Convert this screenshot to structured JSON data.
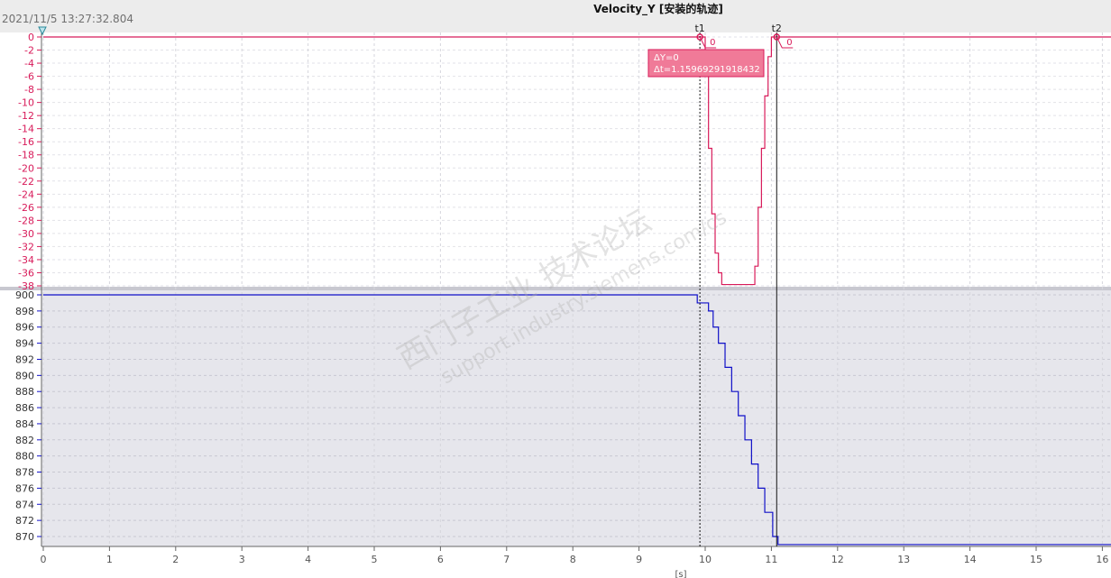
{
  "header": {
    "timestamp": "2021/11/5 13:27:32.804",
    "title": "Velocity_Y [安装的轨迹]"
  },
  "cursors": {
    "t1_label": "t1",
    "t2_label": "t2",
    "t1_value_label": "0",
    "t2_value_label": "0",
    "delta_y": "ΔY=0",
    "delta_t": "Δt=1.15969291918432"
  },
  "watermark": {
    "line1": "西门子工业  技术论坛",
    "line2": "support.industry.siemens.com/cs"
  },
  "colors": {
    "top_series": "#d81b5a",
    "bottom_series": "#1010c8",
    "cursor_box": "#f07a98",
    "lower_panel_bg": "#e6e6ec"
  },
  "chart_data": [
    {
      "type": "line",
      "title": "Velocity_Y [安装的轨迹]",
      "ylim": [
        -39,
        0
      ],
      "yticks": [
        0,
        -2,
        -4,
        -6,
        -8,
        -10,
        -12,
        -14,
        -16,
        -18,
        -20,
        -22,
        -24,
        -26,
        -28,
        -30,
        -32,
        -34,
        -36,
        -38
      ],
      "xlim": [
        0,
        16.2
      ],
      "grid": true,
      "step": true,
      "series": [
        {
          "x": [
            0,
            9.92,
            10.0,
            10.05,
            10.1,
            10.15,
            10.2,
            10.25,
            10.3,
            10.35,
            10.4,
            10.5,
            10.6,
            10.65,
            10.7,
            10.75,
            10.8,
            10.85,
            10.9,
            10.95,
            11.0,
            11.05,
            16.2
          ],
          "y": [
            0,
            0,
            -3,
            -17,
            -27,
            -33,
            -36,
            -37.8,
            -37.8,
            -37.8,
            -37.8,
            -37.8,
            -37.8,
            -37.8,
            -37.8,
            -35,
            -26,
            -17,
            -9,
            -3,
            0,
            0,
            0
          ]
        }
      ]
    },
    {
      "type": "line",
      "ylim": [
        869.5,
        900.8
      ],
      "yticks": [
        900,
        898,
        896,
        894,
        892,
        890,
        888,
        886,
        884,
        882,
        880,
        878,
        876,
        874,
        872,
        870
      ],
      "xlim": [
        0,
        16.2
      ],
      "xticks": [
        0,
        1,
        2,
        3,
        4,
        5,
        6,
        7,
        8,
        9,
        10,
        11,
        12,
        13,
        14,
        15,
        16
      ],
      "xlabel": "[s]",
      "grid": true,
      "step": true,
      "series": [
        {
          "x": [
            0,
            9.88,
            10.05,
            10.12,
            10.2,
            10.3,
            10.4,
            10.5,
            10.6,
            10.7,
            10.8,
            10.9,
            11.02,
            11.1,
            16.2
          ],
          "y": [
            900,
            899,
            898,
            896,
            894,
            891,
            888,
            885,
            882,
            879,
            876,
            873,
            870,
            869,
            870
          ]
        }
      ]
    }
  ]
}
